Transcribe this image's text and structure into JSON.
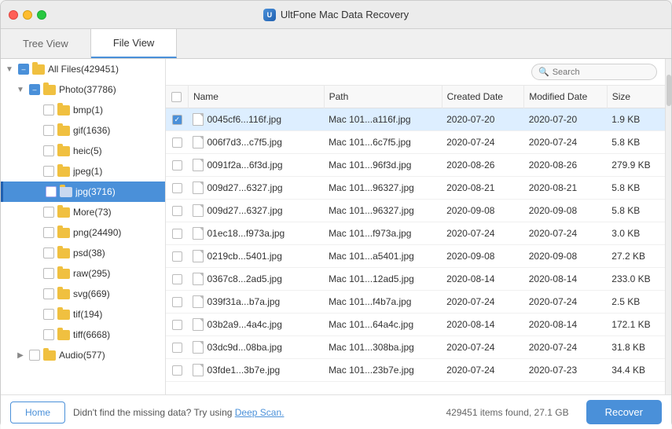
{
  "app": {
    "title": "UltFone Mac Data Recovery",
    "icon": "U"
  },
  "tabs": [
    {
      "id": "tree-view",
      "label": "Tree View",
      "active": false
    },
    {
      "id": "file-view",
      "label": "File View",
      "active": true
    }
  ],
  "sidebar": {
    "items": [
      {
        "id": "all-files",
        "label": "All Files(429451)",
        "level": 0,
        "expanded": true,
        "hasArrow": true,
        "isFolder": true,
        "checked": "partial"
      },
      {
        "id": "photo",
        "label": "Photo(37786)",
        "level": 1,
        "expanded": true,
        "hasArrow": true,
        "isFolder": true,
        "checked": "partial"
      },
      {
        "id": "bmp",
        "label": "bmp(1)",
        "level": 2,
        "expanded": false,
        "hasArrow": false,
        "isFolder": true,
        "checked": false
      },
      {
        "id": "gif",
        "label": "gif(1636)",
        "level": 2,
        "expanded": false,
        "hasArrow": false,
        "isFolder": true,
        "checked": false
      },
      {
        "id": "heic",
        "label": "heic(5)",
        "level": 2,
        "expanded": false,
        "hasArrow": false,
        "isFolder": true,
        "checked": false
      },
      {
        "id": "jpeg",
        "label": "jpeg(1)",
        "level": 2,
        "expanded": false,
        "hasArrow": false,
        "isFolder": true,
        "checked": false
      },
      {
        "id": "jpg",
        "label": "jpg(3716)",
        "level": 2,
        "expanded": false,
        "hasArrow": false,
        "isFolder": true,
        "checked": false,
        "active": true
      },
      {
        "id": "more",
        "label": "More(73)",
        "level": 2,
        "expanded": false,
        "hasArrow": false,
        "isFolder": true,
        "checked": false
      },
      {
        "id": "png",
        "label": "png(24490)",
        "level": 2,
        "expanded": false,
        "hasArrow": false,
        "isFolder": true,
        "checked": false
      },
      {
        "id": "psd",
        "label": "psd(38)",
        "level": 2,
        "expanded": false,
        "hasArrow": false,
        "isFolder": true,
        "checked": false
      },
      {
        "id": "raw",
        "label": "raw(295)",
        "level": 2,
        "expanded": false,
        "hasArrow": false,
        "isFolder": true,
        "checked": false
      },
      {
        "id": "svg",
        "label": "svg(669)",
        "level": 2,
        "expanded": false,
        "hasArrow": false,
        "isFolder": true,
        "checked": false
      },
      {
        "id": "tif",
        "label": "tif(194)",
        "level": 2,
        "expanded": false,
        "hasArrow": false,
        "isFolder": true,
        "checked": false
      },
      {
        "id": "tiff",
        "label": "tiff(6668)",
        "level": 2,
        "expanded": false,
        "hasArrow": false,
        "isFolder": true,
        "checked": false
      },
      {
        "id": "audio",
        "label": "Audio(577)",
        "level": 1,
        "expanded": false,
        "hasArrow": true,
        "isFolder": true,
        "checked": false
      }
    ]
  },
  "search": {
    "placeholder": "Search"
  },
  "table": {
    "columns": [
      "",
      "Name",
      "Path",
      "Created Date",
      "Modified Date",
      "Size"
    ],
    "rows": [
      {
        "id": 1,
        "name": "0045cf6...116f.jpg",
        "path": "Mac 101...a116f.jpg",
        "created": "2020-07-20",
        "modified": "2020-07-20",
        "size": "1.9 KB",
        "selected": true
      },
      {
        "id": 2,
        "name": "006f7d3...c7f5.jpg",
        "path": "Mac 101...6c7f5.jpg",
        "created": "2020-07-24",
        "modified": "2020-07-24",
        "size": "5.8 KB"
      },
      {
        "id": 3,
        "name": "0091f2a...6f3d.jpg",
        "path": "Mac 101...96f3d.jpg",
        "created": "2020-08-26",
        "modified": "2020-08-26",
        "size": "279.9 KB"
      },
      {
        "id": 4,
        "name": "009d27...6327.jpg",
        "path": "Mac 101...96327.jpg",
        "created": "2020-08-21",
        "modified": "2020-08-21",
        "size": "5.8 KB"
      },
      {
        "id": 5,
        "name": "009d27...6327.jpg",
        "path": "Mac 101...96327.jpg",
        "created": "2020-09-08",
        "modified": "2020-09-08",
        "size": "5.8 KB"
      },
      {
        "id": 6,
        "name": "01ec18...f973a.jpg",
        "path": "Mac 101...f973a.jpg",
        "created": "2020-07-24",
        "modified": "2020-07-24",
        "size": "3.0 KB"
      },
      {
        "id": 7,
        "name": "0219cb...5401.jpg",
        "path": "Mac 101...a5401.jpg",
        "created": "2020-09-08",
        "modified": "2020-09-08",
        "size": "27.2 KB"
      },
      {
        "id": 8,
        "name": "0367c8...2ad5.jpg",
        "path": "Mac 101...12ad5.jpg",
        "created": "2020-08-14",
        "modified": "2020-08-14",
        "size": "233.0 KB"
      },
      {
        "id": 9,
        "name": "039f31a...b7a.jpg",
        "path": "Mac 101...f4b7a.jpg",
        "created": "2020-07-24",
        "modified": "2020-07-24",
        "size": "2.5 KB"
      },
      {
        "id": 10,
        "name": "03b2a9...4a4c.jpg",
        "path": "Mac 101...64a4c.jpg",
        "created": "2020-08-14",
        "modified": "2020-08-14",
        "size": "172.1 KB"
      },
      {
        "id": 11,
        "name": "03dc9d...08ba.jpg",
        "path": "Mac 101...308ba.jpg",
        "created": "2020-07-24",
        "modified": "2020-07-24",
        "size": "31.8 KB"
      },
      {
        "id": 12,
        "name": "03fde1...3b7e.jpg",
        "path": "Mac 101...23b7e.jpg",
        "created": "2020-07-24",
        "modified": "2020-07-23",
        "size": "34.4 KB"
      }
    ]
  },
  "bottom": {
    "home_label": "Home",
    "message": "Didn't find the missing data? Try using ",
    "deep_scan_label": "Deep Scan.",
    "status": "429451 items found, 27.1 GB",
    "recover_label": "Recover"
  },
  "colors": {
    "accent": "#4a90d9",
    "selected_row": "#ddeeff",
    "active_sidebar": "#4a90d9"
  }
}
